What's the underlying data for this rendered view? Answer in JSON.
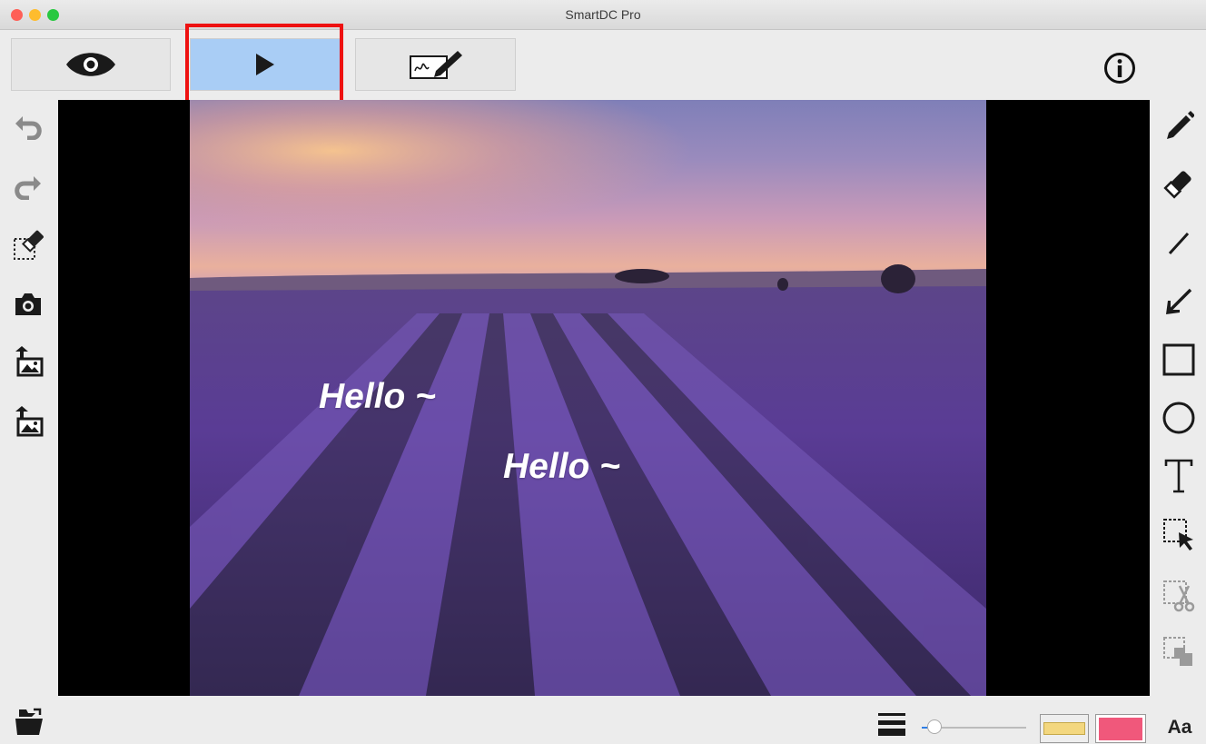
{
  "window": {
    "title": "SmartDC Pro"
  },
  "toolbar": {
    "modes": [
      {
        "name": "view",
        "icon": "eye-icon"
      },
      {
        "name": "play",
        "icon": "play-icon",
        "active": true
      },
      {
        "name": "annotate",
        "icon": "annotate-signature-icon"
      }
    ],
    "info_icon": "info-icon",
    "highlight_color": "#ee1111",
    "active_color": "#a9cdf5"
  },
  "left_tools": [
    "undo-icon",
    "redo-icon",
    "clear-selection-icon",
    "camera-icon",
    "import-image-icon",
    "import-image-icon-2"
  ],
  "right_tools": [
    "pencil-icon",
    "eraser-icon",
    "line-icon",
    "arrow-icon",
    "rectangle-icon",
    "ellipse-icon",
    "text-icon",
    "select-icon",
    "cut-icon",
    "copy-icon"
  ],
  "canvas": {
    "annotations": [
      {
        "text": "Hello ~"
      },
      {
        "text": "Hello ~"
      }
    ]
  },
  "bottom": {
    "folder_icon": "open-folder-icon",
    "line_width_icon": "line-width-icon",
    "slider_value": 0.12,
    "fill_color": "#f3d77f",
    "stroke_color": "#f0587b",
    "font_label": "Aa"
  }
}
